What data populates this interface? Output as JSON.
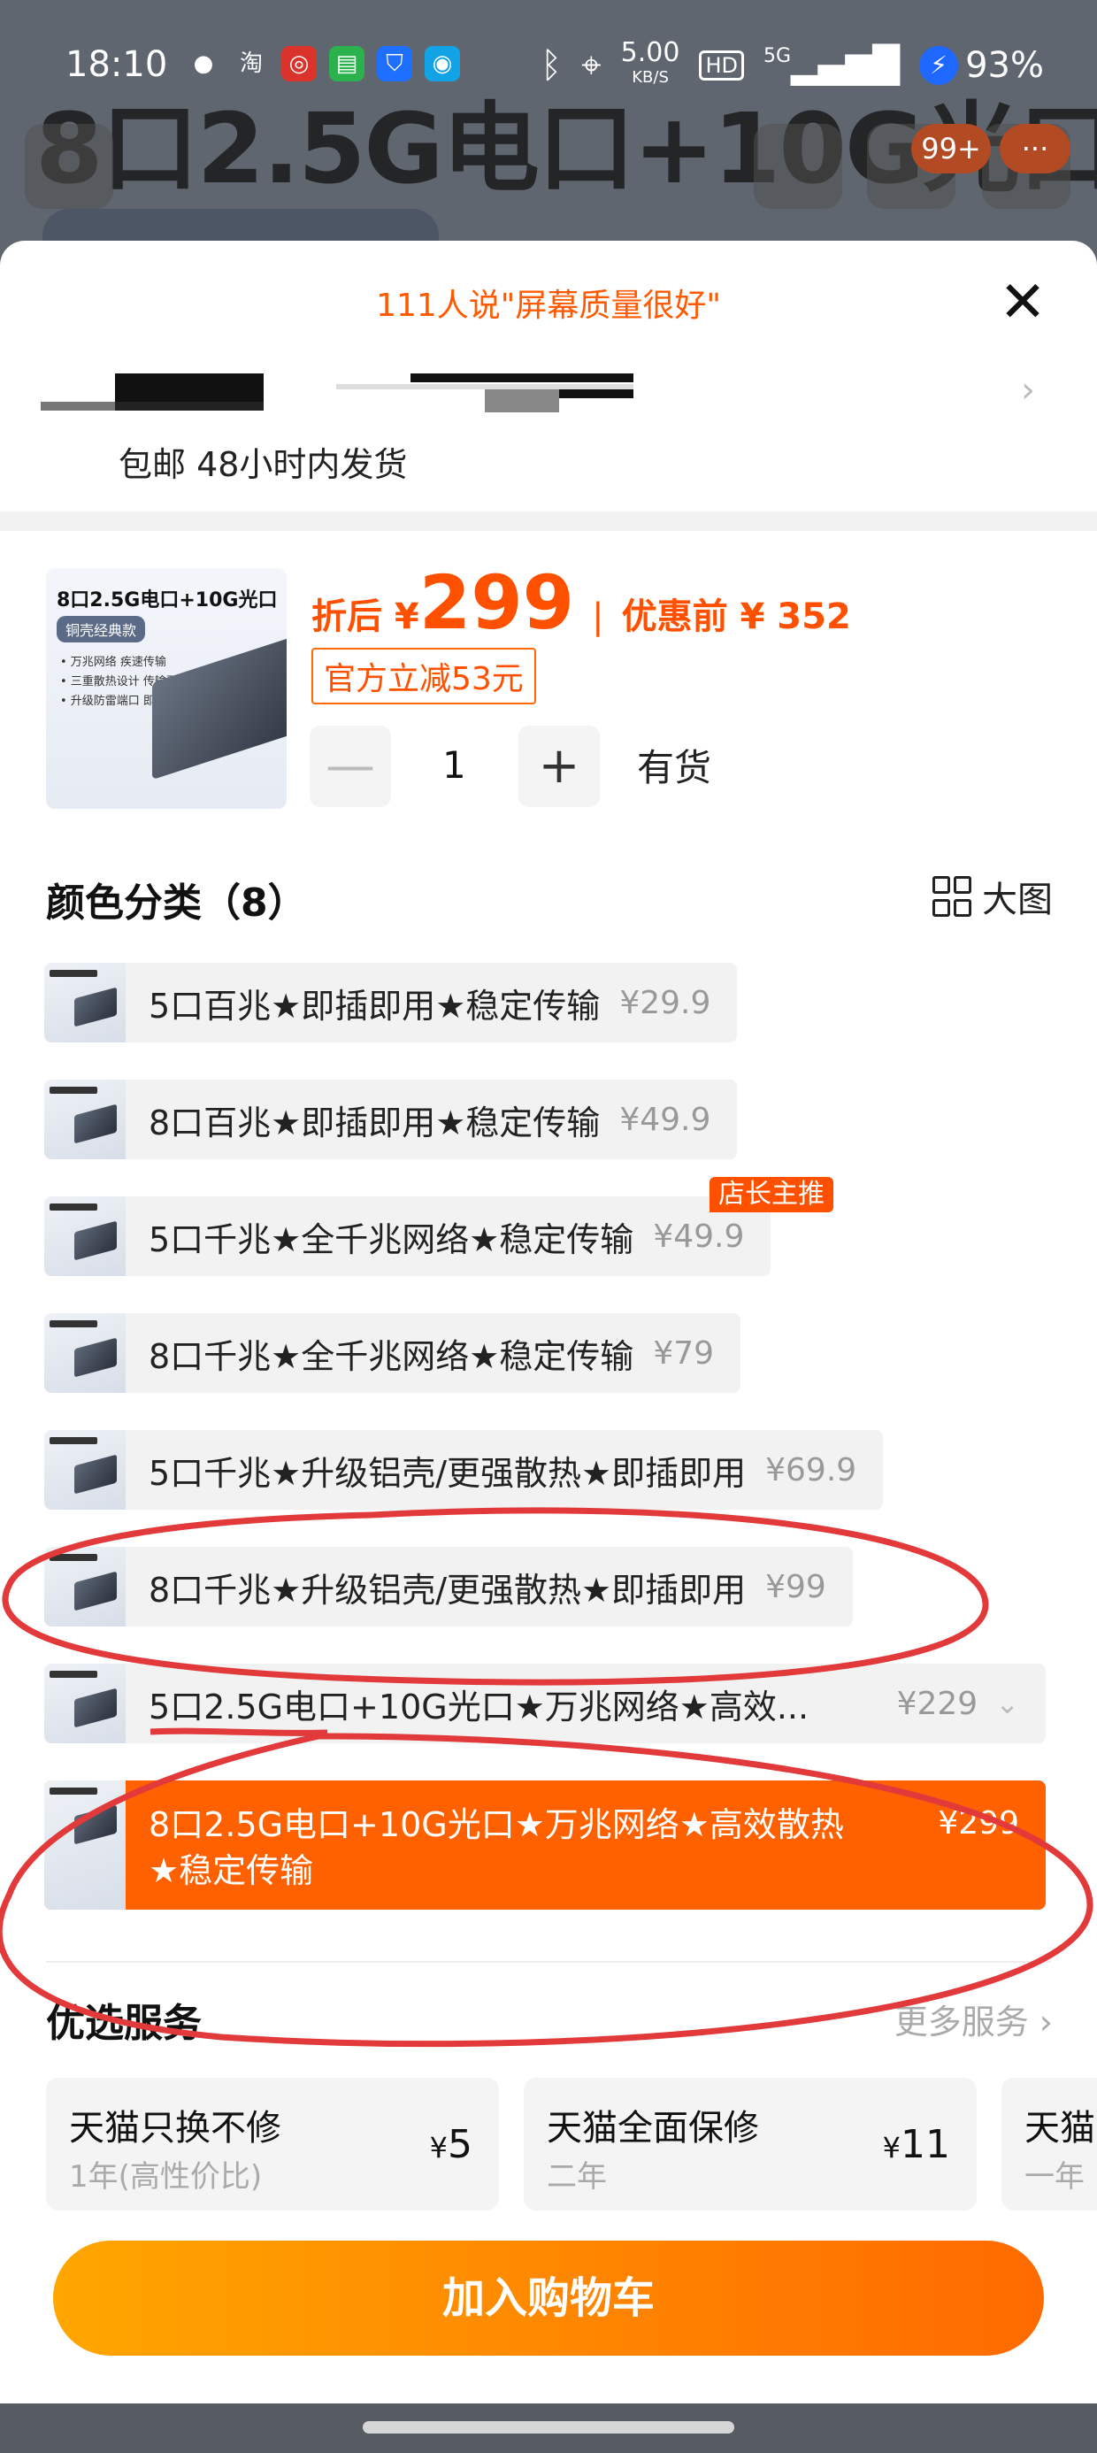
{
  "status_bar": {
    "time": "18:10",
    "net_speed": "5.00",
    "net_unit": "KB/S",
    "hd": "HD",
    "network": "5G",
    "battery": "93%"
  },
  "background_page": {
    "title": "8口2.5G电口+10G光口",
    "cart_badge": "99+"
  },
  "sheet": {
    "review_banner": "111人说\"屏幕质量很好\"",
    "close_label": "✕",
    "shipping": "包邮 48小时内发货"
  },
  "product": {
    "thumb_title": "8口2.5G电口+10G光口",
    "thumb_tag": "铜壳经典款",
    "thumb_bullets": [
      "• 万兆网络 疾速传输",
      "• 三重散热设计 传输更稳定",
      "• 升级防雷端口 即插即用"
    ],
    "price_label": "折后 ¥",
    "price": "299",
    "separator": "|",
    "original_label": "优惠前 ¥ 352",
    "discount_tag": "官方立减53元",
    "quantity": "1",
    "minus": "—",
    "plus": "+",
    "stock": "有货"
  },
  "color_section": {
    "title": "颜色分类（8）",
    "big_view": "大图",
    "options": [
      {
        "name": "5口百兆★即插即用★稳定传输",
        "price": "¥29.9"
      },
      {
        "name": "8口百兆★即插即用★稳定传输",
        "price": "¥49.9"
      },
      {
        "name": "5口千兆★全千兆网络★稳定传输",
        "price": "¥49.9",
        "badge": "店长主推"
      },
      {
        "name": "8口千兆★全千兆网络★稳定传输",
        "price": "¥79"
      },
      {
        "name": "5口千兆★升级铝壳/更强散热★即插即用",
        "price": "¥69.9"
      },
      {
        "name": "8口千兆★升级铝壳/更强散热★即插即用",
        "price": "¥99"
      },
      {
        "name": "5口2.5G电口+10G光口★万兆网络★高效...",
        "price": "¥229"
      },
      {
        "name": "8口2.5G电口+10G光口★万兆网络★高效散热",
        "name_line2": "★稳定传输",
        "price": "¥299"
      }
    ]
  },
  "services": {
    "title": "优选服务",
    "more": "更多服务 ›",
    "cards": [
      {
        "name": "天猫只换不修",
        "sub": "1年(高性价比)",
        "currency": "¥",
        "price": "5"
      },
      {
        "name": "天猫全面保修",
        "sub": "二年",
        "currency": "¥",
        "price": "11"
      },
      {
        "name": "天猫",
        "sub": "一年",
        "currency": "",
        "price": ""
      }
    ]
  },
  "cart_button": "加入购物车",
  "colors": {
    "accent": "#ff6000",
    "price": "#ff5000",
    "annotation": "#e23a3a"
  }
}
